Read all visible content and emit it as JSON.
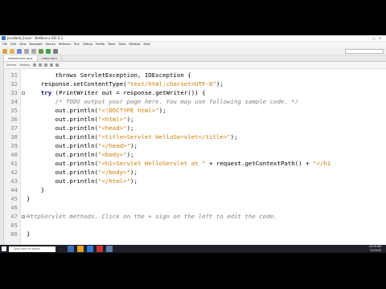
{
  "window": {
    "title": "JavaWeb_Exam - NetBeans IDE 8.2"
  },
  "menubar": {
    "items": [
      "File",
      "Edit",
      "View",
      "Navigate",
      "Source",
      "Refactor",
      "Run",
      "Debug",
      "Profile",
      "Team",
      "Tools",
      "Window",
      "Help"
    ]
  },
  "toolbar": {
    "search_placeholder": "Search (Ctrl+I)"
  },
  "tabs": [
    {
      "label": "HelloServlet.java"
    },
    {
      "label": "index.html"
    }
  ],
  "editor_toolbar": {
    "source_label": "Source",
    "history_label": "History"
  },
  "code_lines": [
    {
      "num": "31",
      "segments": [
        {
          "t": "        throws ServletException, IOException {",
          "c": "code"
        }
      ]
    },
    {
      "num": "32",
      "segments": [
        {
          "t": "    response.setContentType(",
          "c": "code"
        },
        {
          "t": "\"text/html;charset=UTF-8\"",
          "c": "str"
        },
        {
          "t": ");",
          "c": "code"
        }
      ]
    },
    {
      "num": "33",
      "segments": [
        {
          "t": "    ",
          "c": "code"
        },
        {
          "t": "try",
          "c": "kw"
        },
        {
          "t": " (PrintWriter out = response.getWriter()) {",
          "c": "code"
        }
      ]
    },
    {
      "num": "34",
      "segments": [
        {
          "t": "        /* TODO output your page here. You may use following sample code. */",
          "c": "cmt"
        }
      ]
    },
    {
      "num": "35",
      "segments": [
        {
          "t": "        out.println(",
          "c": "code"
        },
        {
          "t": "\"<!DOCTYPE html>\"",
          "c": "str"
        },
        {
          "t": ");",
          "c": "code"
        }
      ]
    },
    {
      "num": "36",
      "segments": [
        {
          "t": "        out.println(",
          "c": "code"
        },
        {
          "t": "\"<html>\"",
          "c": "str"
        },
        {
          "t": ");",
          "c": "code"
        }
      ]
    },
    {
      "num": "37",
      "segments": [
        {
          "t": "        out.println(",
          "c": "code"
        },
        {
          "t": "\"<head>\"",
          "c": "str"
        },
        {
          "t": ");",
          "c": "code"
        }
      ]
    },
    {
      "num": "38",
      "segments": [
        {
          "t": "        out.println(",
          "c": "code"
        },
        {
          "t": "\"<title>Servlet HelloServlet</title>\"",
          "c": "str"
        },
        {
          "t": ");",
          "c": "code"
        }
      ]
    },
    {
      "num": "39",
      "segments": [
        {
          "t": "        out.println(",
          "c": "code"
        },
        {
          "t": "\"</head>\"",
          "c": "str"
        },
        {
          "t": ");",
          "c": "code"
        }
      ]
    },
    {
      "num": "40",
      "segments": [
        {
          "t": "        out.println(",
          "c": "code"
        },
        {
          "t": "\"<body>\"",
          "c": "str"
        },
        {
          "t": ");",
          "c": "code"
        }
      ]
    },
    {
      "num": "41",
      "segments": [
        {
          "t": "        out.println(",
          "c": "code"
        },
        {
          "t": "\"<h1>Servlet HelloServlet at \"",
          "c": "str"
        },
        {
          "t": " + request.getContextPath() + ",
          "c": "code"
        },
        {
          "t": "\"</h1",
          "c": "str"
        }
      ]
    },
    {
      "num": "42",
      "segments": [
        {
          "t": "        out.println(",
          "c": "code"
        },
        {
          "t": "\"</body>\"",
          "c": "str"
        },
        {
          "t": ");",
          "c": "code"
        }
      ]
    },
    {
      "num": "43",
      "segments": [
        {
          "t": "        out.println(",
          "c": "code"
        },
        {
          "t": "\"</html>\"",
          "c": "str"
        },
        {
          "t": ");",
          "c": "code"
        }
      ]
    },
    {
      "num": "44",
      "segments": [
        {
          "t": "    }",
          "c": "code"
        }
      ]
    },
    {
      "num": "45",
      "segments": [
        {
          "t": "}",
          "c": "code"
        }
      ]
    },
    {
      "num": "46",
      "segments": [
        {
          "t": "",
          "c": "code"
        }
      ]
    },
    {
      "num": "47",
      "segments": [
        {
          "t": "HttpServlet methods. Click on the + sign on the left to edit the code.",
          "c": "cmt"
        }
      ]
    },
    {
      "num": "85",
      "segments": [
        {
          "t": "",
          "c": "code"
        }
      ]
    },
    {
      "num": "86",
      "segments": [
        {
          "t": "}",
          "c": "code"
        }
      ]
    }
  ],
  "taskbar": {
    "search_placeholder": "Type here to search",
    "time": "10:15 AM",
    "date": "7/2/2020"
  },
  "colors": {
    "keyword": "#000080",
    "string": "#ce7b00",
    "comment": "#808080"
  }
}
